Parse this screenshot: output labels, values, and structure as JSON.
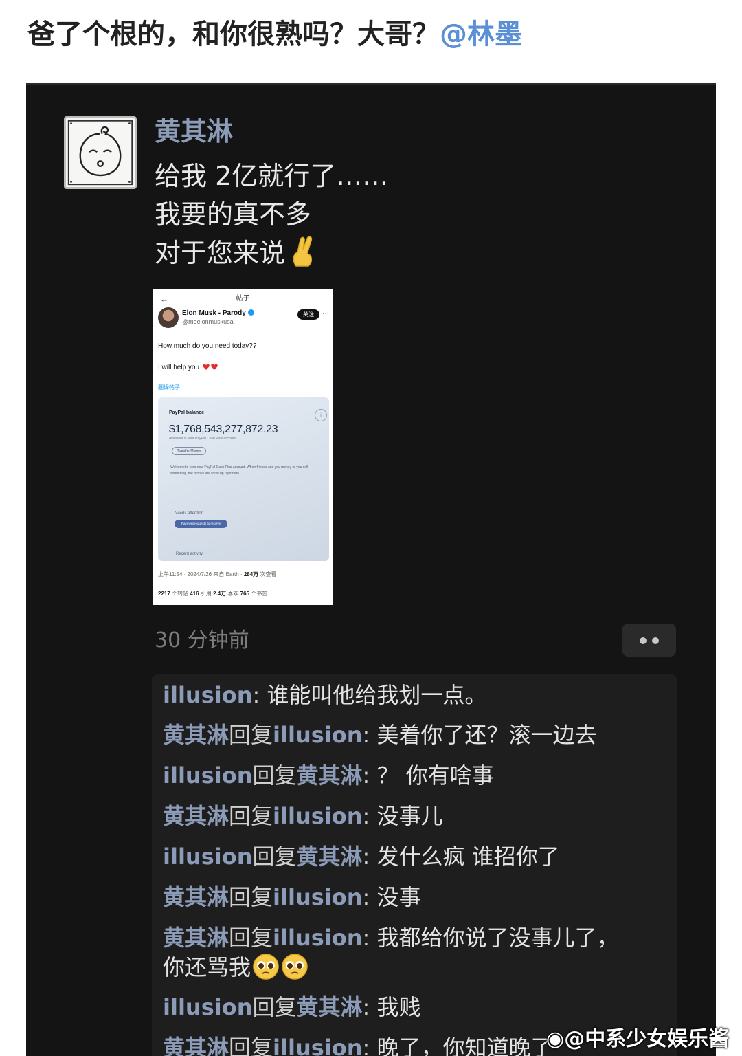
{
  "post": {
    "caption": "爸了个根的，和你很熟吗？大哥？",
    "mention": "@林墨"
  },
  "chat": {
    "author": "黄其淋",
    "message_lines": [
      "给我 2亿就行了……",
      "我要的真不多",
      "对于您来说"
    ],
    "time": "30 分钟前"
  },
  "tweet": {
    "back_glyph": "←",
    "title": "帖子",
    "name": "Elon Musk - Parody",
    "handle": "@meelonmuskusa",
    "follow_label": "关注",
    "more_glyph": "···",
    "text_line1": "How much do you need today??",
    "text_line2": "I will help you",
    "translate_label": "翻译帖子",
    "card": {
      "label": "PayPal balance",
      "balance": "$1,768,543,277,872.23",
      "sub": "Available in your PayPal Cash Plus account",
      "transfer_label": "Transfer Money",
      "welcome": "Welcome to your new PayPal Cash Plus account. When friends and you money or you sell something, the money will show up right here.",
      "attention": "Needs attention",
      "resolve_label": "Payment requests to resolve",
      "recent": "Recent activity"
    },
    "meta_time": "上午11:54 · 2024/7/26 来自 Earth · ",
    "meta_views_num": "284万",
    "meta_views_label": " 次查看",
    "stats": {
      "reposts_num": "2217",
      "reposts_label": " 个转帖  ",
      "quotes_num": "416",
      "quotes_label": " 引用  ",
      "likes_num": "2.4万",
      "likes_label": " 喜欢  ",
      "bookmarks_num": "765",
      "bookmarks_label": " 个书签"
    }
  },
  "replies": [
    {
      "from": "illusion",
      "sep": ": ",
      "to": "",
      "joiner": "",
      "text": "谁能叫他给我划一点。"
    },
    {
      "from": "黄其淋",
      "sep": "",
      "joiner": "回复",
      "to": "illusion",
      "colon": ": ",
      "text": "美着你了还？滚一边去"
    },
    {
      "from": "illusion",
      "sep": "",
      "joiner": "回复",
      "to": "黄其淋",
      "colon": ": ",
      "text": "？ 你有啥事"
    },
    {
      "from": "黄其淋",
      "sep": "",
      "joiner": "回复",
      "to": "illusion",
      "colon": ": ",
      "text": "没事儿"
    },
    {
      "from": "illusion",
      "sep": "",
      "joiner": "回复",
      "to": "黄其淋",
      "colon": ": ",
      "text": "发什么疯 谁招你了"
    },
    {
      "from": "黄其淋",
      "sep": "",
      "joiner": "回复",
      "to": "illusion",
      "colon": ": ",
      "text": "没事"
    },
    {
      "from": "黄其淋",
      "sep": "",
      "joiner": "回复",
      "to": "illusion",
      "colon": ": ",
      "text": "我都给你说了没事儿了，",
      "text2": "你还骂我"
    },
    {
      "from": "illusion",
      "sep": "",
      "joiner": "回复",
      "to": "黄其淋",
      "colon": ": ",
      "text": "我贱"
    },
    {
      "from": "黄其淋",
      "sep": "",
      "joiner": "回复",
      "to": "illusion",
      "colon": ": ",
      "text": "晚了，你知道晚了"
    }
  ],
  "watermark": "@中系少女娱乐酱",
  "icons": {
    "fingers": "crossed-fingers-emoji",
    "pleading": "pleading-face-emoji",
    "heart": "red-heart-emoji",
    "weibo": "weibo-logo-icon"
  },
  "colors": {
    "accent_name": "#8c9cb8",
    "mention": "#5b8fd6",
    "background_dark": "#141414"
  }
}
